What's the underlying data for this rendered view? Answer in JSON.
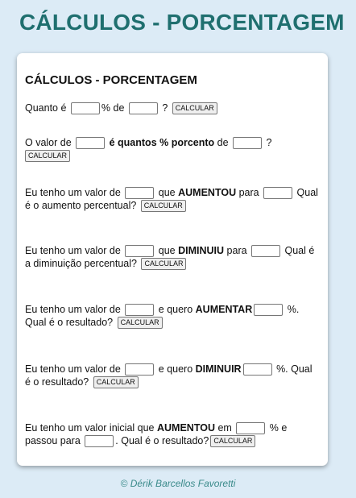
{
  "header": {
    "title": "CÁLCULOS - PORCENTAGEM"
  },
  "card": {
    "title": "CÁLCULOS - PORCENTAGEM"
  },
  "button_label": "CALCULAR",
  "calc1": {
    "t1": "Quanto é ",
    "t2": "% de ",
    "t3": " ?"
  },
  "calc2": {
    "t1": "O valor de ",
    "t2": " é quantos % porcento",
    "t3": " de ",
    "t4": " ?"
  },
  "calc3": {
    "t1": "Eu tenho um valor de ",
    "t2": " que ",
    "t3": "AUMENTOU",
    "t4": " para ",
    "t5": " Qual é o aumento percentual?"
  },
  "calc4": {
    "t1": "Eu tenho um valor de ",
    "t2": " que ",
    "t3": "DIMINUIU",
    "t4": " para ",
    "t5": " Qual é a diminuição percentual?"
  },
  "calc5": {
    "t1": "Eu tenho um valor de ",
    "t2": " e quero ",
    "t3": "AUMENTAR",
    "t4": " %. Qual é o resultado?"
  },
  "calc6": {
    "t1": "Eu tenho um valor de ",
    "t2": " e quero ",
    "t3": "DIMINUIR",
    "t4": " %. Qual é o resultado?"
  },
  "calc7": {
    "t1": "Eu tenho um valor inicial que ",
    "t2": "AUMENTOU",
    "t3": " em ",
    "t4": " % e passou para ",
    "t5": ". Qual é o resultado?"
  },
  "footer": {
    "text": "© Dérik Barcellos Favoretti"
  },
  "colors": {
    "title": "#1f6f6f",
    "background": "#dcebf6",
    "footer": "#3a8a8a"
  }
}
